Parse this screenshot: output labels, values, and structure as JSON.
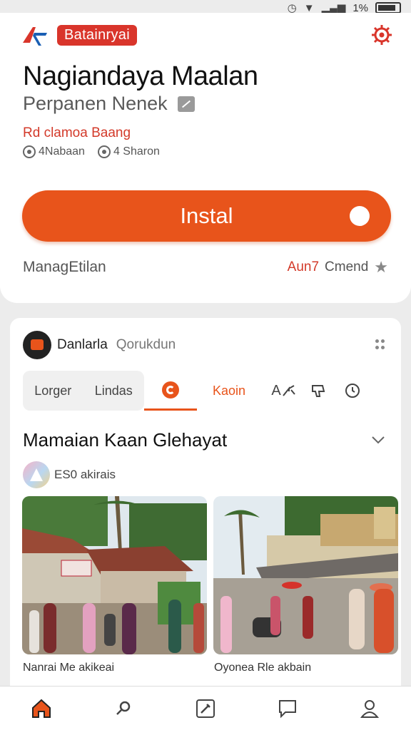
{
  "status": {
    "battery_text": "1%"
  },
  "app": {
    "badge": "Batainryai",
    "title": "Nagiandaya Maalan",
    "subtitle": "Perpanen Nenek",
    "developer": "Rd clamoa Baang",
    "meta": [
      "4Nabaan",
      "4 Sharon"
    ],
    "install_label": "Instal",
    "manage_label": "ManagEtilan",
    "rating_red": "Aun7",
    "rating_grey": "Cmend"
  },
  "feed": {
    "channel_name": "Danlarla",
    "channel_meta": "Qorukdun",
    "tabs_left": [
      "Lorger",
      "Lindas"
    ],
    "tab_active": "Kaoin",
    "tab_icon_a": "A",
    "section_title": "Mamaian Kaan Glehayat",
    "sub_label": "ES0 akirais",
    "captions": [
      "Nanrai Me akikeai",
      "Oyonea Rle akbain"
    ]
  },
  "colors": {
    "accent": "#e8541b",
    "brand_red": "#d9352b"
  }
}
